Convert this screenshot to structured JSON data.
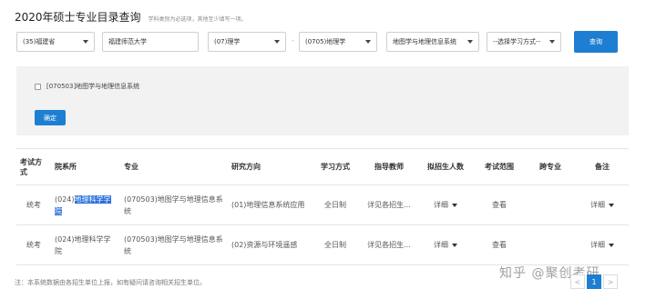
{
  "header": {
    "title": "2020年硕士专业目录查询",
    "hint": "学科类别为必选项，其他至少填写一项。"
  },
  "filters": {
    "province": "(35)福建省",
    "university": "福建师范大学",
    "category": "(07)理学",
    "discipline": "(0705)地理学",
    "major": "地图学与地理信息系统",
    "study_mode": "--选择学习方式--",
    "query_label": "查询"
  },
  "panel": {
    "major_option": "[070503]地图学与地理信息系统",
    "confirm_label": "确定"
  },
  "table": {
    "headers": [
      "考试方式",
      "院系所",
      "专业",
      "研究方向",
      "学习方式",
      "指导教师",
      "拟招生人数",
      "考试范围",
      "跨专业",
      "备注"
    ],
    "rows": [
      {
        "exam": "统考",
        "dept_prefix": "(024)",
        "dept_highlight": "地理科学学院",
        "major": "(070503)地图学与地理信息系统",
        "direction": "(01)地理信息系统应用",
        "mode": "全日制",
        "advisor": "详见各招生...",
        "quota": "详细",
        "scope": "查看",
        "cross": "",
        "note": "详细"
      },
      {
        "exam": "统考",
        "dept": "(024)地理科学学院",
        "major": "(070503)地图学与地理信息系统",
        "direction": "(02)资源与环境遥感",
        "mode": "全日制",
        "advisor": "详见各招生...",
        "quota": "详细",
        "scope": "查看",
        "cross": "",
        "note": "详细"
      }
    ]
  },
  "footnote": "注：本系统数据由各招生单位上报，如有疑问请咨询相关招生单位。",
  "watermark": "知乎 @聚创考研",
  "pagination": {
    "prev": "<",
    "current": "1",
    "next": ">"
  },
  "colors": {
    "accent": "#1e7fd2",
    "highlight": "#2a6fdb",
    "panel": "#f2f2f2"
  }
}
